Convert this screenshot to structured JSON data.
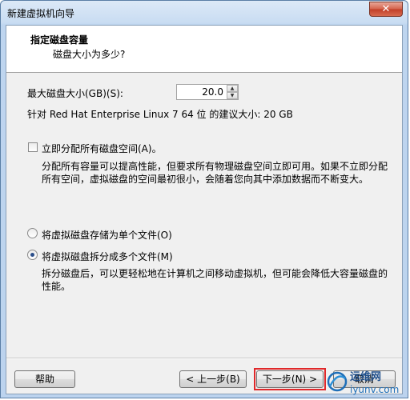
{
  "window": {
    "title": "新建虚拟机向导",
    "close_glyph": "✕"
  },
  "header": {
    "title": "指定磁盘容量",
    "subtitle": "磁盘大小为多少?"
  },
  "disk": {
    "max_size_label": "最大磁盘大小(GB)(S):",
    "max_size_value": "20.0",
    "recommendation": "针对 Red Hat Enterprise Linux 7 64 位 的建议大小: 20 GB"
  },
  "allocate": {
    "checkbox_label": "立即分配所有磁盘空间(A)。",
    "checked": false,
    "description": "分配所有容量可以提高性能，但要求所有物理磁盘空间立即可用。如果不立即分配所有空间，虚拟磁盘的空间最初很小，会随着您向其中添加数据而不断变大。"
  },
  "storage": {
    "single_file_label": "将虚拟磁盘存储为单个文件(O)",
    "multi_file_label": "将虚拟磁盘拆分成多个文件(M)",
    "selected": "multi",
    "multi_description": "拆分磁盘后，可以更轻松地在计算机之间移动虚拟机，但可能会降低大容量磁盘的性能。"
  },
  "buttons": {
    "help": "帮助",
    "back": "< 上一步(B)",
    "next": "下一步(N) >",
    "cancel": "取消"
  },
  "watermark": {
    "line1": "运维网",
    "line2": "iyunv.com"
  },
  "colors": {
    "highlight": "#e0282a",
    "title_gradient_top": "#dce9f7",
    "title_gradient_bottom": "#bcd3ee"
  }
}
